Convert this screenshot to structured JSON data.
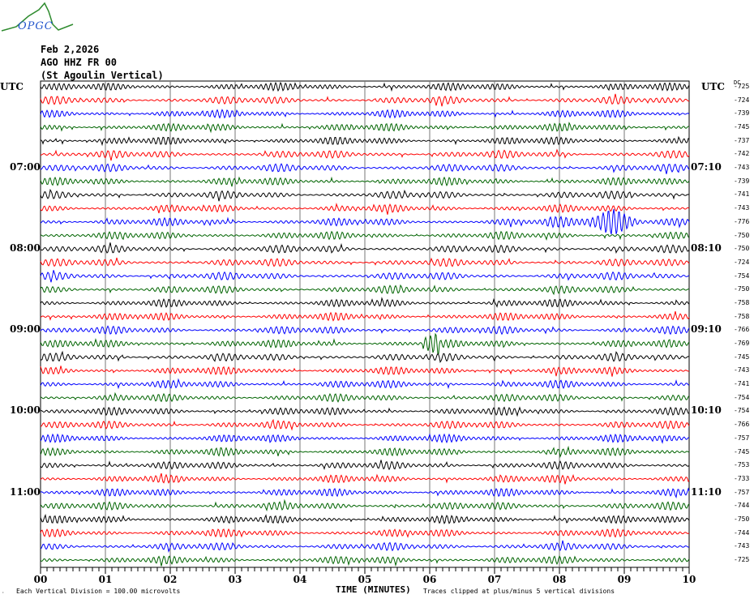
{
  "logo": {
    "text": "OPGC"
  },
  "header": {
    "date": "Feb 2,2026",
    "station": "AGO HHZ FR 00",
    "location": "(St Agoulin Vertical)"
  },
  "left_utc": "UTC",
  "right_utc": "UTC",
  "dc_label": "DC",
  "trace_colors": [
    "#000000",
    "#ff0000",
    "#0000ff",
    "#006400"
  ],
  "chart_data": {
    "type": "line",
    "title": "AGO HHZ FR 00 (St Agoulin Vertical) Feb 2,2026",
    "xlabel": "TIME (MINUTES)",
    "xlim": [
      0,
      10
    ],
    "x_ticks": [
      "00",
      "01",
      "02",
      "03",
      "04",
      "05",
      "06",
      "07",
      "08",
      "09",
      "10"
    ],
    "left_hour_labels": [
      {
        "row": 6,
        "text": "07:00"
      },
      {
        "row": 12,
        "text": "08:00"
      },
      {
        "row": 18,
        "text": "09:00"
      },
      {
        "row": 24,
        "text": "10:00"
      },
      {
        "row": 30,
        "text": "11:00"
      }
    ],
    "right_hour_labels": [
      {
        "row": 6,
        "text": "07:10"
      },
      {
        "row": 12,
        "text": "08:10"
      },
      {
        "row": 18,
        "text": "09:10"
      },
      {
        "row": 24,
        "text": "10:10"
      },
      {
        "row": 30,
        "text": "11:10"
      }
    ],
    "dc_offsets": [
      "-725",
      "-724",
      "-739",
      "-745",
      "-737",
      "-742",
      "-743",
      "-739",
      "-741",
      "-743",
      "-776",
      "-750",
      "-750",
      "-724",
      "-754",
      "-750",
      "-758",
      "-758",
      "-766",
      "-769",
      "-745",
      "-743",
      "-741",
      "-754",
      "-754",
      "-766",
      "-757",
      "-745",
      "-753",
      "-733",
      "-757",
      "-744",
      "-750",
      "-744",
      "-743",
      "-725"
    ],
    "events": [
      {
        "row": 10,
        "start_min": 7.8,
        "peak_min": 8.8,
        "end_min": 10
      },
      {
        "row": 19,
        "start_min": 5.9,
        "peak_min": 6.0,
        "end_min": 6.15
      }
    ]
  },
  "footer": {
    "scale": "Each Vertical Division =  100.00 microvolts",
    "time_label": "TIME (MINUTES)",
    "clip_note": "Traces clipped at plus/minus 5 vertical divisions"
  }
}
